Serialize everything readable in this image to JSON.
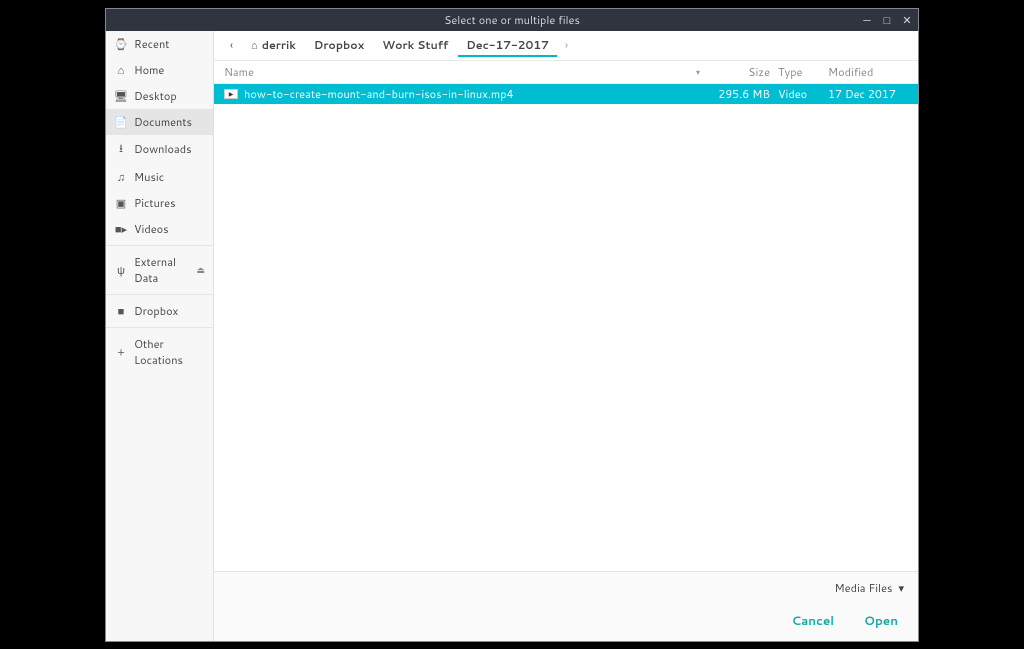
{
  "titlebar": {
    "text": "Select one or multiple files"
  },
  "sidebar": {
    "items": [
      {
        "icon": "⌚",
        "label": "Recent"
      },
      {
        "icon": "⌂",
        "label": "Home"
      },
      {
        "icon": "🖥",
        "label": "Desktop"
      },
      {
        "icon": "📄",
        "label": "Documents"
      },
      {
        "icon": "⭳",
        "label": "Downloads"
      },
      {
        "icon": "♫",
        "label": "Music"
      },
      {
        "icon": "▣",
        "label": "Pictures"
      },
      {
        "icon": "■▸",
        "label": "Videos"
      }
    ],
    "external": {
      "icon": "ψ",
      "label": "External Data",
      "eject": "⏏"
    },
    "dropbox": {
      "icon": "■",
      "label": "Dropbox"
    },
    "other": {
      "icon": "+",
      "label": "Other Locations"
    }
  },
  "path": {
    "back": "‹",
    "crumbs": [
      "derrik",
      "Dropbox",
      "Work Stuff",
      "Dec-17-2017"
    ],
    "forward": "›"
  },
  "columns": {
    "name": "Name",
    "size": "Size",
    "type": "Type",
    "modified": "Modified"
  },
  "files": [
    {
      "name": "how-to-create-mount-and-burn-isos-in-linux.mp4",
      "size": "295.6 MB",
      "type": "Video",
      "modified": "17 Dec 2017"
    }
  ],
  "footer": {
    "filter": "Media Files",
    "cancel": "Cancel",
    "open": "Open"
  }
}
